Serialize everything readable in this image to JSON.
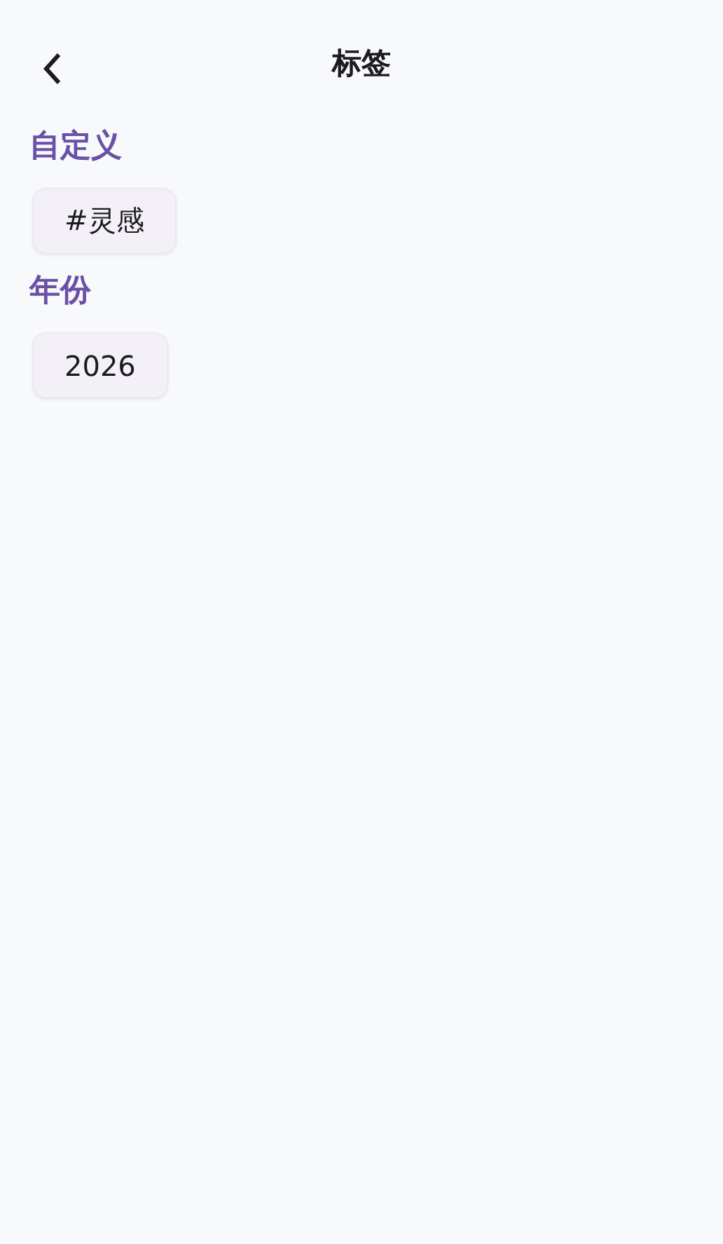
{
  "header": {
    "title": "标签"
  },
  "sections": [
    {
      "heading": "自定义",
      "tags": [
        "#灵感"
      ]
    },
    {
      "heading": "年份",
      "tags": [
        "2026"
      ]
    }
  ]
}
